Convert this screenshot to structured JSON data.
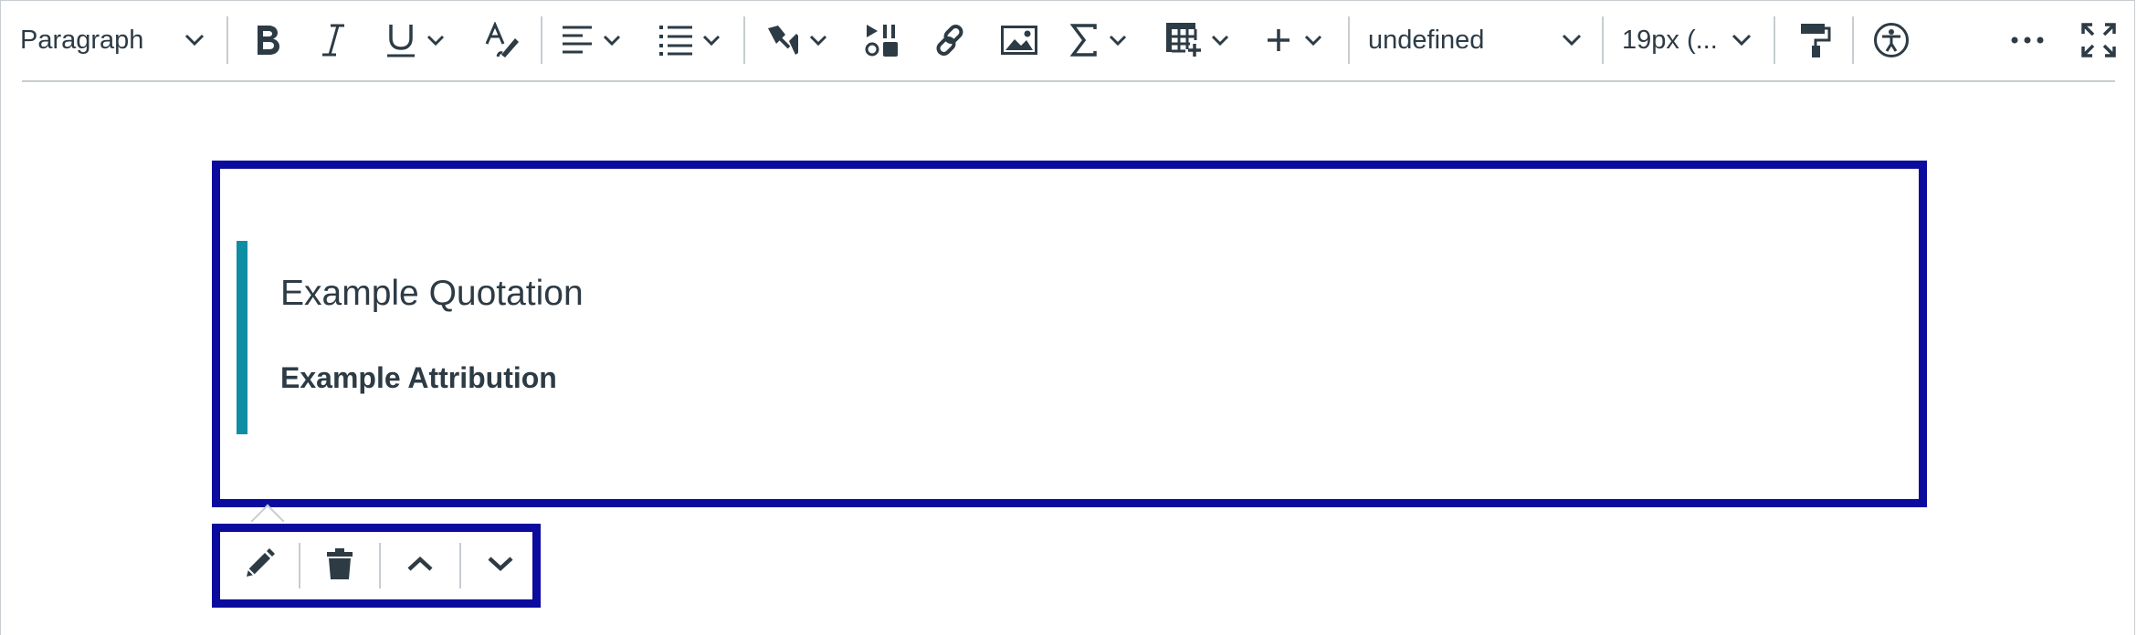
{
  "toolbar": {
    "block_format": {
      "value": "Paragraph"
    },
    "buttons": {
      "bold": "bold-icon",
      "italic": "italic-icon",
      "underline": "underline-icon",
      "text_color": "text-color-icon",
      "align": "align-left-icon",
      "list": "bulleted-list-icon",
      "pen": "pen-icon",
      "media": "media-icon",
      "link": "link-icon",
      "image": "image-icon",
      "equation": "sigma-icon",
      "table": "table-icon",
      "insert": "plus-icon",
      "format_painter": "paint-roller-icon",
      "accessibility": "accessibility-icon",
      "more": "more-icon",
      "fullscreen": "fullscreen-icon"
    },
    "font_family": {
      "value": "undefined"
    },
    "font_size": {
      "value": "19px (..."
    }
  },
  "editor": {
    "quote": {
      "text": "Example Quotation",
      "attribution": "Example Attribution"
    }
  },
  "block_actions": {
    "items": [
      "edit-icon",
      "trash-icon",
      "move-up-icon",
      "move-down-icon"
    ]
  },
  "colors": {
    "selection_outline": "#0b0b9e",
    "quote_accent": "#0d8ea3",
    "text": "#2d3b45",
    "divider": "#c7cdd1"
  }
}
